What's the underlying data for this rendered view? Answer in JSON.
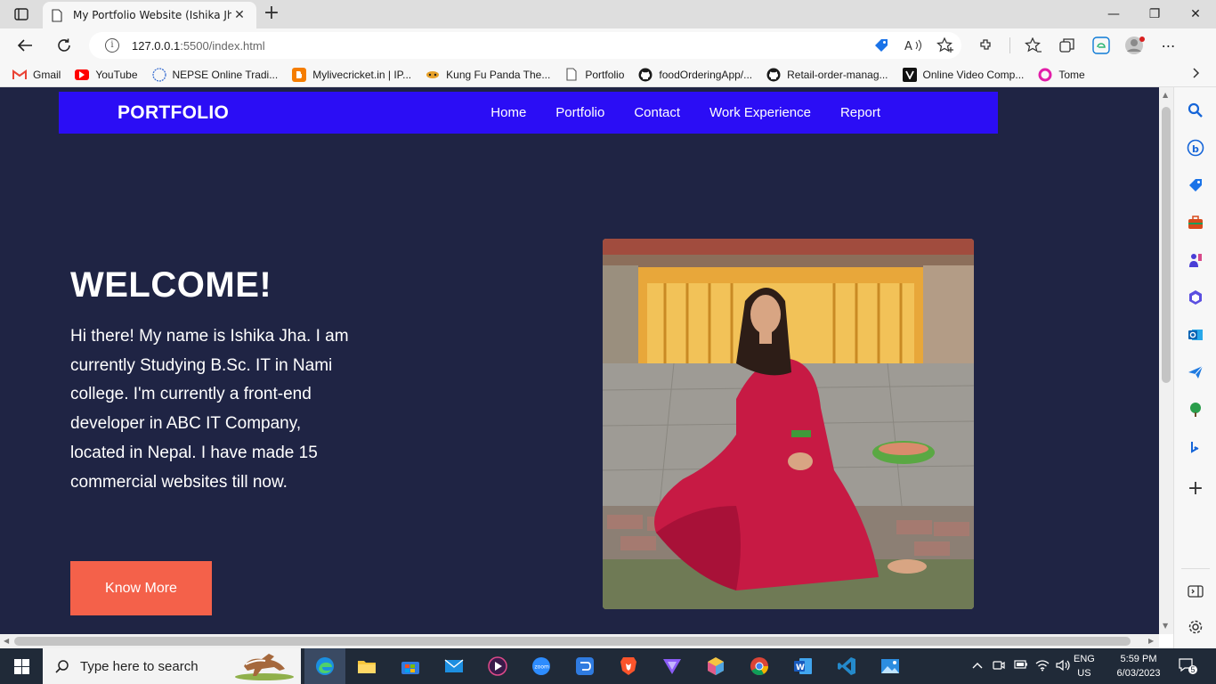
{
  "browser": {
    "tab": {
      "title": "My Portfolio Website (Ishika Jha)",
      "close": "✕"
    },
    "new_tab": "+",
    "window_controls": {
      "minimize": "—",
      "maximize": "❐",
      "close": "✕"
    },
    "url": {
      "host": "127.0.0.1",
      "rest": ":5500/index.html"
    },
    "bookmarks": [
      {
        "label": "Gmail",
        "icon": "gmail-icon",
        "color": "#ea4335"
      },
      {
        "label": "YouTube",
        "icon": "youtube-icon",
        "color": "#ff0000"
      },
      {
        "label": "NEPSE Online Tradi...",
        "icon": "nepse-icon",
        "color": "#3b6fd1"
      },
      {
        "label": "Mylivecricket.in | IP...",
        "icon": "blogger-icon",
        "color": "#f57d00"
      },
      {
        "label": "Kung Fu Panda The...",
        "icon": "panda-icon",
        "color": "#e7a12a"
      },
      {
        "label": "Portfolio",
        "icon": "page-icon",
        "color": "#555555"
      },
      {
        "label": "foodOrderingApp/...",
        "icon": "github-icon",
        "color": "#1b1b1b"
      },
      {
        "label": "Retail-order-manag...",
        "icon": "github-icon",
        "color": "#1b1b1b"
      },
      {
        "label": "Online Video Comp...",
        "icon": "v-icon",
        "color": "#111111"
      },
      {
        "label": "Tome",
        "icon": "tome-icon",
        "color": "#e21ea8"
      }
    ]
  },
  "site": {
    "brand": "PORTFOLIO",
    "nav": [
      "Home",
      "Portfolio",
      "Contact",
      "Work Experience",
      "Report"
    ],
    "hero": {
      "title": "WELCOME!",
      "text": "Hi there! My name is Ishika Jha. I am currently Studying B.Sc. IT in Nami college. I'm currently a front-end developer in ABC IT Company, located in Nepal. I have made 15 commercial websites till now.",
      "cta": "Know More"
    },
    "colors": {
      "background": "#1f2444",
      "nav": "#2b0df5",
      "cta": "#f4614a"
    }
  },
  "taskbar": {
    "search_placeholder": "Type here to search",
    "lang_top": "ENG",
    "lang_bottom": "US",
    "time": "5:59 PM",
    "date": "6/03/2023",
    "notifications": "5"
  }
}
